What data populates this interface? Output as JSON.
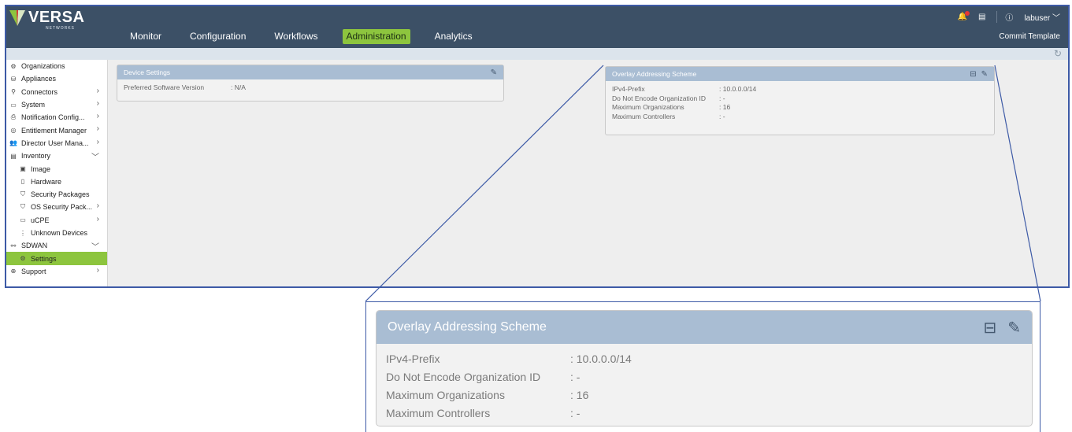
{
  "app": {
    "logo_text": "VERSA",
    "logo_sub": "NETWORKS",
    "nav": [
      "Monitor",
      "Configuration",
      "Workflows",
      "Administration",
      "Analytics"
    ],
    "active_nav": "Administration",
    "user": "labuser",
    "commit_label": "Commit Template"
  },
  "sidebar": {
    "items": [
      {
        "label": "Organizations",
        "icon": "org-icon",
        "chevron": ""
      },
      {
        "label": "Appliances",
        "icon": "appliance-icon",
        "chevron": ""
      },
      {
        "label": "Connectors",
        "icon": "connector-icon",
        "chevron": ">"
      },
      {
        "label": "System",
        "icon": "system-icon",
        "chevron": ">"
      },
      {
        "label": "Notification Config...",
        "icon": "notification-icon",
        "chevron": ">"
      },
      {
        "label": "Entitlement Manager",
        "icon": "entitlement-icon",
        "chevron": ">"
      },
      {
        "label": "Director User Mana...",
        "icon": "users-icon",
        "chevron": ">"
      },
      {
        "label": "Inventory",
        "icon": "inventory-icon",
        "chevron": "v"
      },
      {
        "label": "Image",
        "icon": "image-icon",
        "chevron": "",
        "sub": true
      },
      {
        "label": "Hardware",
        "icon": "hardware-icon",
        "chevron": "",
        "sub": true
      },
      {
        "label": "Security Packages",
        "icon": "shield-icon",
        "chevron": "",
        "sub": true
      },
      {
        "label": "OS Security Pack...",
        "icon": "shield-icon",
        "chevron": ">",
        "sub": true
      },
      {
        "label": "uCPE",
        "icon": "ucpe-icon",
        "chevron": ">",
        "sub": true
      },
      {
        "label": "Unknown Devices",
        "icon": "unknown-device-icon",
        "chevron": "",
        "sub": true
      },
      {
        "label": "SDWAN",
        "icon": "sdwan-icon",
        "chevron": "v"
      },
      {
        "label": "Settings",
        "icon": "settings-icon",
        "chevron": "",
        "sub": true,
        "active": true
      },
      {
        "label": "Support",
        "icon": "support-icon",
        "chevron": ">"
      }
    ]
  },
  "device_settings": {
    "title": "Device Settings",
    "rows": [
      {
        "key": "Preferred Software Version",
        "value": ": N/A"
      }
    ]
  },
  "overlay": {
    "title": "Overlay Addressing Scheme",
    "rows": [
      {
        "key": "IPv4-Prefix",
        "value": ": 10.0.0.0/14"
      },
      {
        "key": "Do Not Encode Organization ID",
        "value": ": -"
      },
      {
        "key": "Maximum Organizations",
        "value": ": 16"
      },
      {
        "key": "Maximum Controllers",
        "value": ": -"
      }
    ]
  },
  "colors": {
    "topbar": "#3c5066",
    "accent": "#8dc53e",
    "panel_header": "#a9bdd3"
  }
}
